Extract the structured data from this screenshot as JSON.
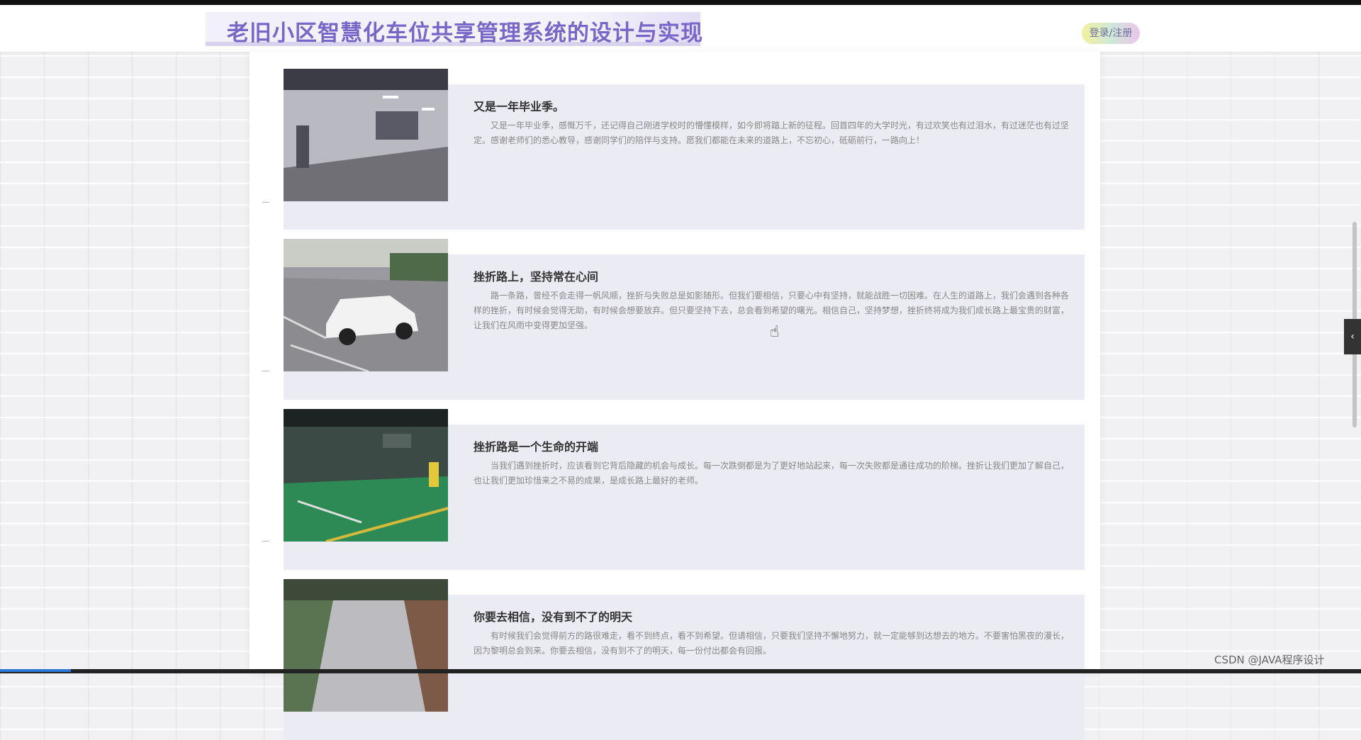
{
  "header": {
    "site_title": "老旧小区智慧化车位共享管理系统的设计与实现",
    "login_label": "登录/注册"
  },
  "articles": [
    {
      "title": "又是一年毕业季。",
      "thumb_icon": "parking-garage-photo",
      "excerpt": "又是一年毕业季，感慨万千，还记得自己刚进学校时的懵懂模样，如今即将踏上新的征程。回首四年的大学时光，有过欢笑也有过泪水，有过迷茫也有过坚定。感谢老师们的悉心教导，感谢同学们的陪伴与支持。愿我们都能在未来的道路上，不忘初心，砥砺前行，一路向上！"
    },
    {
      "title": "挫折路上，坚持常在心间",
      "thumb_icon": "white-car-photo",
      "excerpt": "路一条路，曾经不会走得一帆风顺，挫折与失败总是如影随形。但我们要相信，只要心中有坚持，就能战胜一切困难。在人生的道路上，我们会遇到各种各样的挫折，有时候会觉得无助，有时候会想要放弃。但只要坚持下去，总会看到希望的曙光。相信自己，坚持梦想，挫折终将成为我们成长路上最宝贵的财富，让我们在风雨中变得更加坚强。"
    },
    {
      "title": "挫折路是一个生命的开端",
      "thumb_icon": "green-parking-lot-photo",
      "excerpt": "当我们遇到挫折时，应该看到它背后隐藏的机会与成长。每一次跌倒都是为了更好地站起来，每一次失败都是通往成功的阶梯。挫折让我们更加了解自己，也让我们更加珍惜来之不易的成果，是成长路上最好的老师。"
    },
    {
      "title": "你要去相信，没有到不了的明天",
      "thumb_icon": "alley-road-photo",
      "excerpt": "有时候我们会觉得前方的路很难走，看不到终点，看不到希望。但请相信，只要我们坚持不懈地努力，就一定能够到达想去的地方。不要害怕黑夜的漫长，因为黎明总会到来。你要去相信，没有到不了的明天，每一份付出都会有回报。"
    }
  ],
  "watermark": "CSDN @JAVA程序设计"
}
